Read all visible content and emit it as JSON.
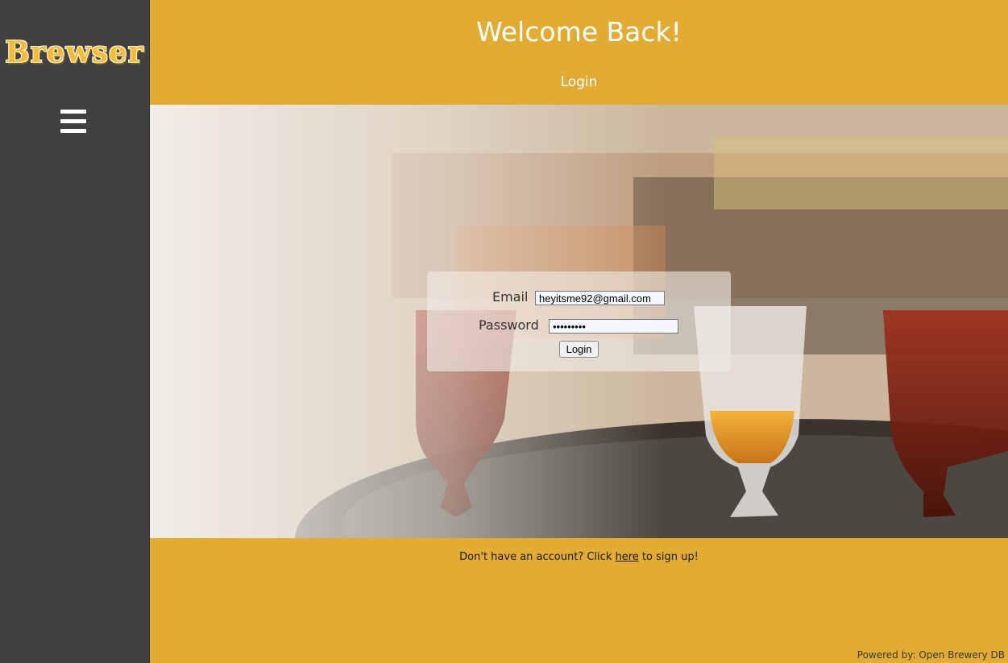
{
  "brand": {
    "logo_text": "Brewser"
  },
  "sidebar": {
    "menu_icon": "hamburger-menu-icon"
  },
  "header": {
    "title": "Welcome Back!",
    "subtitle": "Login"
  },
  "login_form": {
    "email_label": "Email",
    "email_value": "heyitsme92@gmail.com",
    "password_label": "Password",
    "password_value": "•••••••••",
    "submit_label": "Login"
  },
  "signup": {
    "prefix": "Don't have an account? Click ",
    "link_text": "here",
    "suffix": " to sign up!"
  },
  "footer": {
    "powered_by": "Powered by: Open Brewery DB"
  },
  "colors": {
    "accent": "#e1ab34",
    "sidebar": "#414141",
    "text_light": "#ffffff"
  }
}
